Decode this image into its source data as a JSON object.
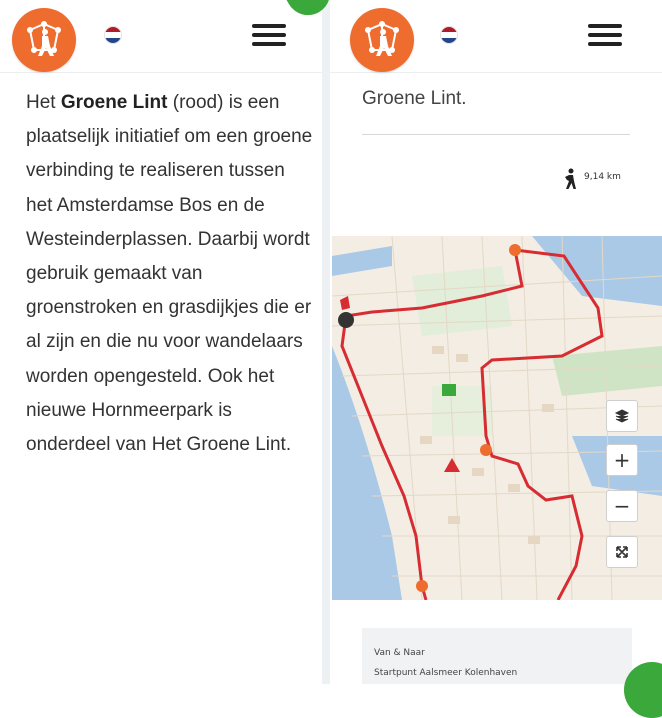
{
  "colors": {
    "brand": "#ef6c2f",
    "route": "#d62c32",
    "accent_green": "#3aa83a",
    "water": "#aac9e6"
  },
  "icons": {
    "logo": "hiker-logo-icon",
    "flag": "flag-nl-icon",
    "menu": "hamburger-menu-icon",
    "walk": "walking-person-icon",
    "layers": "layers-icon",
    "zoom_in": "plus-icon",
    "zoom_out": "minus-icon",
    "fullscreen": "fullscreen-icon"
  },
  "left": {
    "intro_prefix": "Het ",
    "intro_bold": "Groene Lint",
    "intro_rest": " (rood) is een plaatselijk initiatief om een groene verbinding te realiseren tussen het Amsterdamse Bos en de Westeinderplassen. Daarbij wordt gebruik gemaakt van groenstroken en grasdijkjes die er al zijn en die nu voor wandelaars worden opengesteld. Ook het nieuwe Hornmeerpark is onderdeel van Het Groene Lint."
  },
  "right": {
    "title": "Groene Lint.",
    "distance": "9,14 km",
    "map": {
      "zoom_in": "+",
      "zoom_out": "−"
    },
    "info": {
      "label": "Van & Naar",
      "value": "Startpunt Aalsmeer Kolenhaven"
    }
  }
}
